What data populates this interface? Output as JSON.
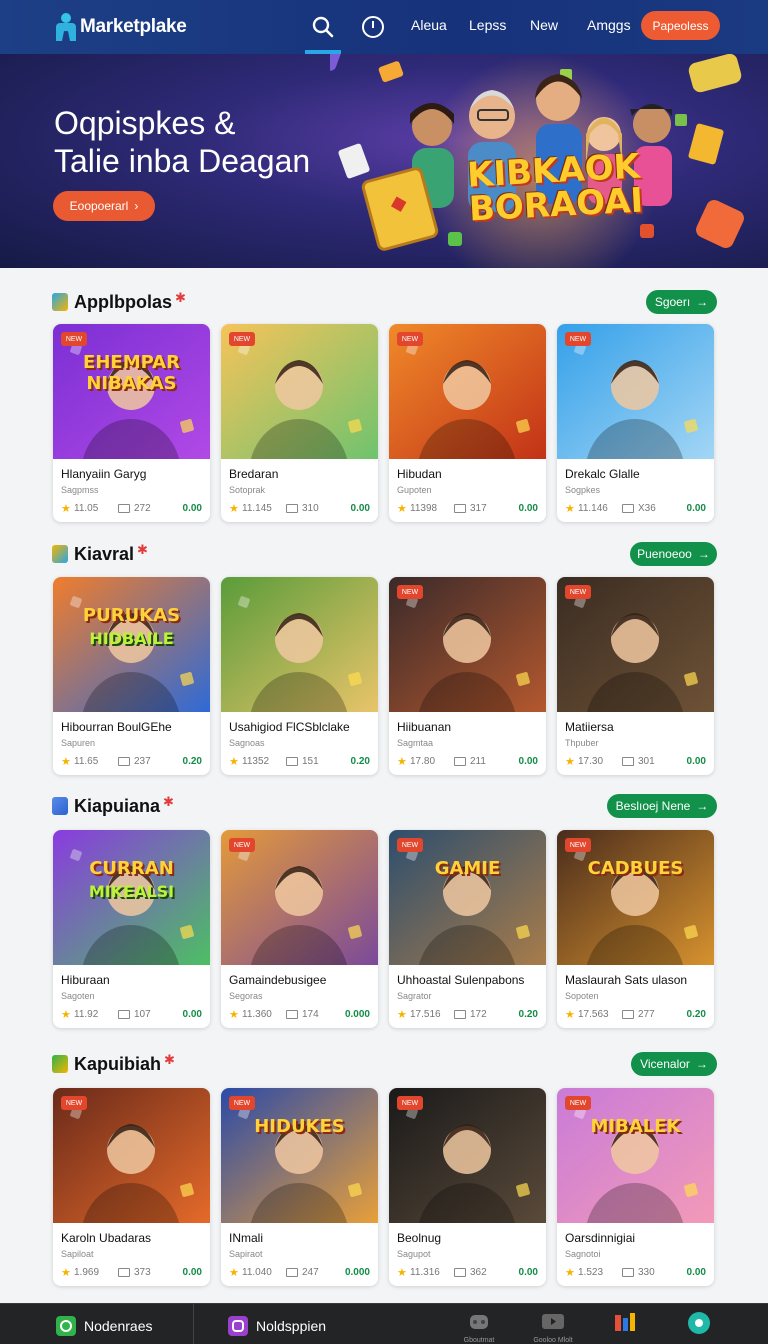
{
  "header": {
    "brand": "Marketplake",
    "nav": [
      "Aleua",
      "Lepss",
      "New",
      "Amggs"
    ],
    "cta": "Papeoless"
  },
  "hero": {
    "title_line1": "Oqpispkes &",
    "title_line2": "Talie inba Deagan",
    "button": "Eoopoerarl",
    "logo_line1": "KIBKAOK",
    "logo_line2": "BORAOAI"
  },
  "sections": [
    {
      "title": "Applbpolas",
      "button": "Sgoerı",
      "cards": [
        {
          "tag": "NEW",
          "name": "Hlanyaiin Garyg",
          "sub": "Sagpmss",
          "rating": "11.05",
          "count": "272",
          "price": "0.00",
          "art_text": "EHEMPAR NIBAKAS"
        },
        {
          "tag": "NEW",
          "name": "Bredaran",
          "sub": "Sotoprak",
          "rating": "11.145",
          "count": "310",
          "price": "0.00"
        },
        {
          "tag": "NEW",
          "name": "Hibudan",
          "sub": "Gupoten",
          "rating": "11398",
          "count": "317",
          "price": "0.00"
        },
        {
          "tag": "NEW",
          "name": "Drekalc Glalle",
          "sub": "Sogpkes",
          "rating": "11.146",
          "count": "X36",
          "price": "0.00"
        }
      ]
    },
    {
      "title": "Kiavral",
      "button": "Puenoeoo",
      "cards": [
        {
          "tag": "",
          "name": "Hibourran BoulGEhe",
          "sub": "Sapuren",
          "rating": "11.65",
          "count": "237",
          "price": "0.20",
          "art_text": "PURUKAS",
          "art_text2": "HIDBAILE"
        },
        {
          "tag": "",
          "name": "Usahigiod FlCSblclake",
          "sub": "Sagnoas",
          "rating": "11352",
          "count": "151",
          "price": "0.20"
        },
        {
          "tag": "NEW",
          "name": "Hiibuanan",
          "sub": "Sagmtaa",
          "rating": "17.80",
          "count": "211",
          "price": "0.00"
        },
        {
          "tag": "NEW",
          "name": "Matiiersa",
          "sub": "Thpuber",
          "rating": "17.30",
          "count": "301",
          "price": "0.00"
        }
      ]
    },
    {
      "title": "Kiapuiana",
      "button": "Beslıoej Nene",
      "cards": [
        {
          "tag": "",
          "name": "Hiburaan",
          "sub": "Sagoten",
          "rating": "11.92",
          "count": "107",
          "price": "0.00",
          "art_text": "CURRAN",
          "art_text2": "MIKEALSI"
        },
        {
          "tag": "NEW",
          "name": "Gamaindebusigee",
          "sub": "Segoras",
          "rating": "11.360",
          "count": "174",
          "price": "0.000"
        },
        {
          "tag": "NEW",
          "name": "Uhhoastal Sulenpabons",
          "sub": "Sagrator",
          "rating": "17.516",
          "count": "172",
          "price": "0.20",
          "art_text": "GAMIE"
        },
        {
          "tag": "NEW",
          "name": "Maslaurah Sats ulason",
          "sub": "Sopoten",
          "rating": "17.563",
          "count": "277",
          "price": "0.20",
          "art_text": "CADBUES"
        }
      ]
    },
    {
      "title": "Kapuibiah",
      "button": "Vicenalor",
      "cards": [
        {
          "tag": "NEW",
          "name": "Karoln Ubadaras",
          "sub": "Sapiloat",
          "rating": "1.969",
          "count": "373",
          "price": "0.00"
        },
        {
          "tag": "NEW",
          "name": "INmali",
          "sub": "Sapiraot",
          "rating": "11.040",
          "count": "247",
          "price": "0.000",
          "art_text": "HIDUKES"
        },
        {
          "tag": "NEW",
          "name": "Beolnug",
          "sub": "Sagupot",
          "rating": "11.316",
          "count": "362",
          "price": "0.00"
        },
        {
          "tag": "NEW",
          "name": "Oarsdinnigiai",
          "sub": "Sagnotoi",
          "rating": "1.523",
          "count": "330",
          "price": "0.00",
          "art_text": "MIBALEK"
        }
      ]
    }
  ],
  "bottom_bar": {
    "left1": "Nodenraes",
    "left2": "Noldsppien",
    "right_labels": [
      "Gboutmat",
      "Gooloo Mlolt",
      "",
      ""
    ]
  },
  "colors": {
    "nav_bg": "#1c3b82",
    "accent_orange": "#ee5b33",
    "section_button_green": "#11914a",
    "price_green": "#138d46",
    "star_yellow": "#f5b400"
  }
}
